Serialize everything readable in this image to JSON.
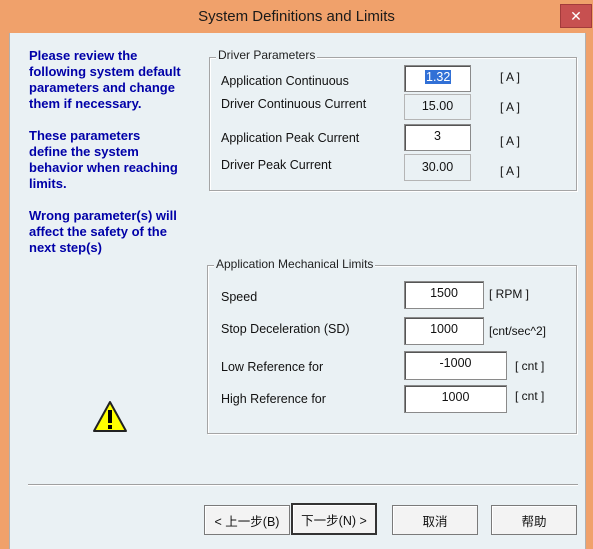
{
  "window": {
    "title": "System Definitions and Limits",
    "close_glyph": "✕"
  },
  "info": {
    "review": [
      "Please review the",
      "following system default",
      "parameters and change",
      "them if necessary."
    ],
    "define": [
      "These parameters",
      "define the system",
      "behavior when reaching",
      "limits."
    ],
    "warning": [
      "Wrong parameter(s) will",
      "affect the safety of the",
      "next step(s)"
    ]
  },
  "driver_parameters": {
    "title": "Driver Parameters",
    "rows": [
      {
        "label": "Application  Continuous",
        "value": "1.32",
        "unit": "[ A ]"
      },
      {
        "label": "Driver Continuous Current",
        "value": "15.00",
        "unit": "[ A ]"
      },
      {
        "label": "Application  Peak Current",
        "value": "3",
        "unit": "[ A ]"
      },
      {
        "label": "Driver Peak Current",
        "value": "30.00",
        "unit": "[ A ]"
      }
    ]
  },
  "mechanical_limits": {
    "title": "Application Mechanical Limits",
    "rows": [
      {
        "label": "Speed",
        "value": "1500",
        "unit": "[ RPM ]"
      },
      {
        "label": "Stop Deceleration (SD)",
        "value": "1000",
        "unit": "[cnt/sec^2]"
      },
      {
        "label": "Low Reference for",
        "value": "-1000",
        "unit": "[ cnt ]"
      },
      {
        "label": "High Reference for",
        "value": "1000",
        "unit": "[ cnt ]"
      }
    ]
  },
  "buttons": {
    "back": "< 上一步(B)",
    "next": "下一步(N) >",
    "cancel": "取消",
    "help": "帮助"
  },
  "colors": {
    "titlebar": "#f0a16b",
    "info_text": "#0000a8",
    "warning_fill": "#ffff00"
  }
}
